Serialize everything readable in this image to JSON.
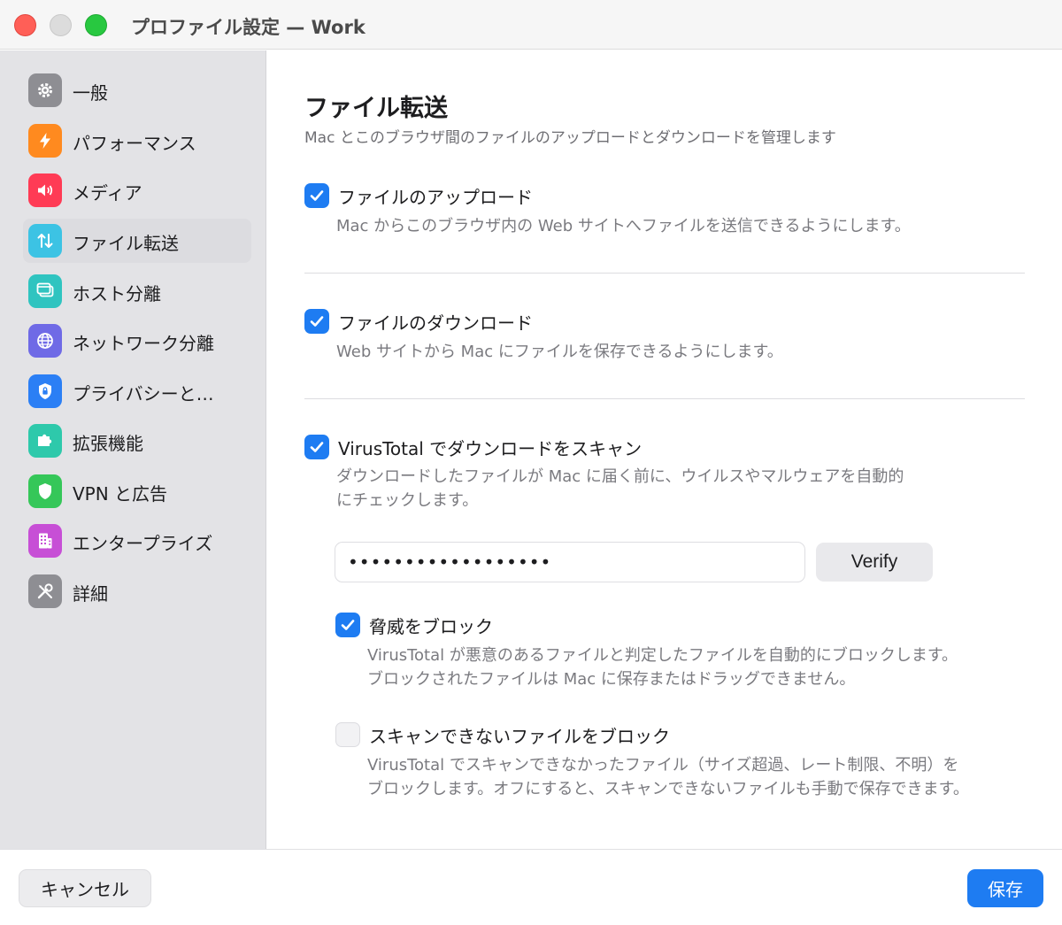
{
  "window": {
    "title": "プロファイル設定 — Work"
  },
  "sidebar": {
    "items": [
      {
        "label": "一般",
        "icon": "gear-icon",
        "color": "#8e8e93"
      },
      {
        "label": "パフォーマンス",
        "icon": "bolt-icon",
        "color": "#ff8a1f"
      },
      {
        "label": "メディア",
        "icon": "speaker-icon",
        "color": "#ff3b55"
      },
      {
        "label": "ファイル転送",
        "icon": "transfer-arrows-icon",
        "color": "#3cc3e4",
        "selected": true
      },
      {
        "label": "ホスト分離",
        "icon": "window-stack-icon",
        "color": "#2fc4c0"
      },
      {
        "label": "ネットワーク分離",
        "icon": "globe-icon",
        "color": "#6f6ae6"
      },
      {
        "label": "プライバシーと…",
        "icon": "lock-shield-icon",
        "color": "#2b7ff5"
      },
      {
        "label": "拡張機能",
        "icon": "puzzle-icon",
        "color": "#2ec9ab"
      },
      {
        "label": "VPN と広告",
        "icon": "shield-icon",
        "color": "#35c759"
      },
      {
        "label": "エンタープライズ",
        "icon": "building-icon",
        "color": "#c74fd6"
      },
      {
        "label": "詳細",
        "icon": "tools-icon",
        "color": "#8e8e93"
      }
    ]
  },
  "main": {
    "title": "ファイル転送",
    "subtitle": "Mac とこのブラウザ間のファイルのアップロードとダウンロードを管理します",
    "upload": {
      "label": "ファイルのアップロード",
      "description": "Mac からこのブラウザ内の Web サイトへファイルを送信できるようにします。",
      "checked": true
    },
    "download": {
      "label": "ファイルのダウンロード",
      "description": "Web サイトから Mac にファイルを保存できるようにします。",
      "checked": true
    },
    "virustotal": {
      "label": "VirusTotal でダウンロードをスキャン",
      "description_line1": "ダウンロードしたファイルが Mac に届く前に、ウイルスやマルウェアを自動的",
      "description_line2": "にチェックします。",
      "checked": true,
      "api_key_value": "••••••••••••••••••",
      "verify_label": "Verify"
    },
    "block_threats": {
      "label": "脅威をブロック",
      "description_line1": "VirusTotal が悪意のあるファイルと判定したファイルを自動的にブロックします。",
      "description_line2": "ブロックされたファイルは Mac に保存またはドラッグできません。",
      "checked": true
    },
    "block_unscannable": {
      "label": "スキャンできないファイルをブロック",
      "description_line1": "VirusTotal でスキャンできなかったファイル（サイズ超過、レート制限、不明）を",
      "description_line2": "ブロックします。オフにすると、スキャンできないファイルも手動で保存できます。",
      "checked": false
    }
  },
  "footer": {
    "cancel_label": "キャンセル",
    "save_label": "保存"
  },
  "colors": {
    "accent": "#1e7cf2",
    "sidebar_bg": "#e3e3e6"
  }
}
